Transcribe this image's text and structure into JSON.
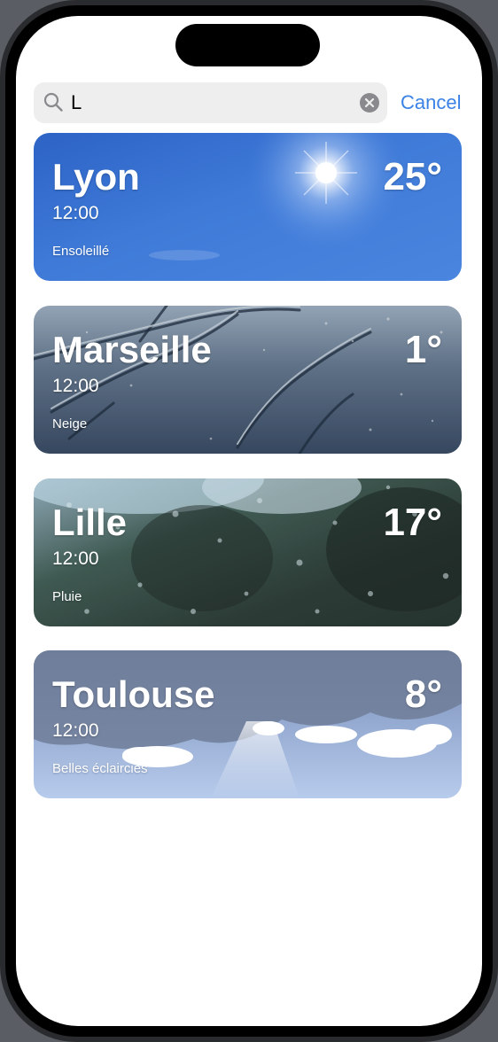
{
  "search": {
    "query": "L",
    "cancel_label": "Cancel"
  },
  "results": [
    {
      "city": "Lyon",
      "time": "12:00",
      "condition": "Ensoleillé",
      "temperature": "25°"
    },
    {
      "city": "Marseille",
      "time": "12:00",
      "condition": "Neige",
      "temperature": "1°"
    },
    {
      "city": "Lille",
      "time": "12:00",
      "condition": "Pluie",
      "temperature": "17°"
    },
    {
      "city": "Toulouse",
      "time": "12:00",
      "condition": "Belles éclaircies",
      "temperature": "8°"
    }
  ],
  "colors": {
    "accent": "#3b82e6",
    "sunny": "#3f7ad8",
    "snow": "#6c7f96",
    "rain": "#2c3b36",
    "cloudy": "#93a8cf"
  }
}
